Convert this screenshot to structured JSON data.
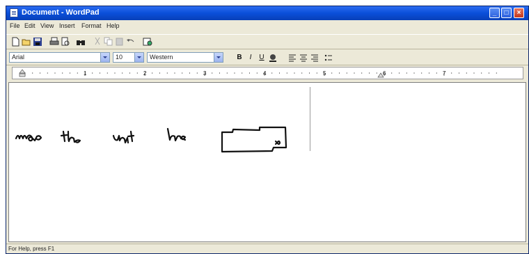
{
  "window": {
    "title": "Document - WordPad",
    "min_icon": "minimize-icon",
    "max_icon": "maximize-icon",
    "close_icon": "close-icon",
    "title_color": "#0a4fd9"
  },
  "menu": [
    "File",
    "Edit",
    "View",
    "Insert",
    "Format",
    "Help"
  ],
  "toolbar": {
    "icons": [
      "new-icon",
      "open-icon",
      "save-icon",
      "print-icon",
      "print-preview-icon",
      "find-icon",
      "cut-icon",
      "copy-icon",
      "paste-icon",
      "undo-icon",
      "date-time-icon"
    ]
  },
  "format_bar": {
    "font": "Arial",
    "size": "10",
    "script": "Western",
    "buttons": [
      "bold-icon",
      "italic-icon",
      "underline-icon",
      "color-icon",
      "align-left-icon",
      "align-center-icon",
      "align-right-icon",
      "bullets-icon"
    ]
  },
  "ruler": {
    "numbers": [
      "1",
      "2",
      "3",
      "4",
      "5",
      "6",
      "7"
    ]
  },
  "document": {
    "handwritten_words": [
      "move",
      "the",
      "unit",
      "here"
    ],
    "sketch": "handwritten-shape"
  },
  "status": {
    "text": "For Help, press F1"
  }
}
